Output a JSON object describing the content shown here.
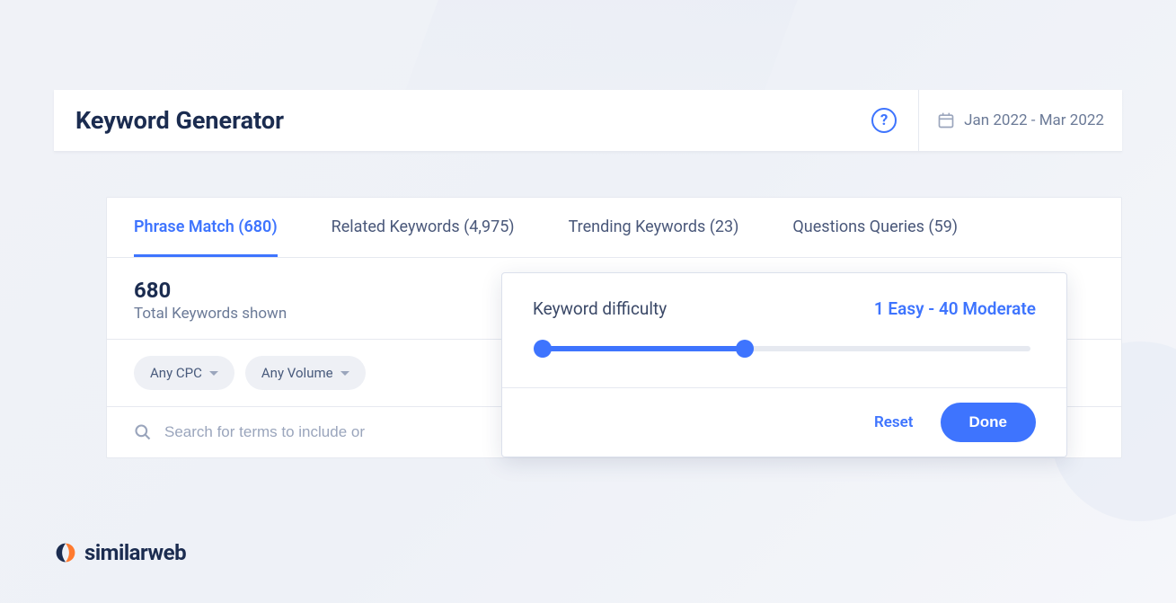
{
  "header": {
    "title": "Keyword Generator",
    "date_range": "Jan 2022 - Mar 2022"
  },
  "tabs": [
    {
      "label": "Phrase Match (680)"
    },
    {
      "label": "Related Keywords (4,975)"
    },
    {
      "label": "Trending Keywords (23)"
    },
    {
      "label": "Questions Queries (59)"
    }
  ],
  "summary": {
    "count": "680",
    "label": "Total Keywords shown"
  },
  "filters": {
    "cpc": "Any CPC",
    "volume": "Any Volume"
  },
  "search": {
    "placeholder": "Search for terms to include or"
  },
  "popover": {
    "title": "Keyword difficulty",
    "value": "1 Easy - 40 Moderate",
    "reset": "Reset",
    "done": "Done",
    "slider": {
      "min": 1,
      "max": 100,
      "low": 1,
      "high": 40
    }
  },
  "brand": {
    "name": "similarweb"
  },
  "colors": {
    "accent": "#3e74fe",
    "text_dark": "#1b2c50",
    "text_muted": "#6b7a97"
  }
}
